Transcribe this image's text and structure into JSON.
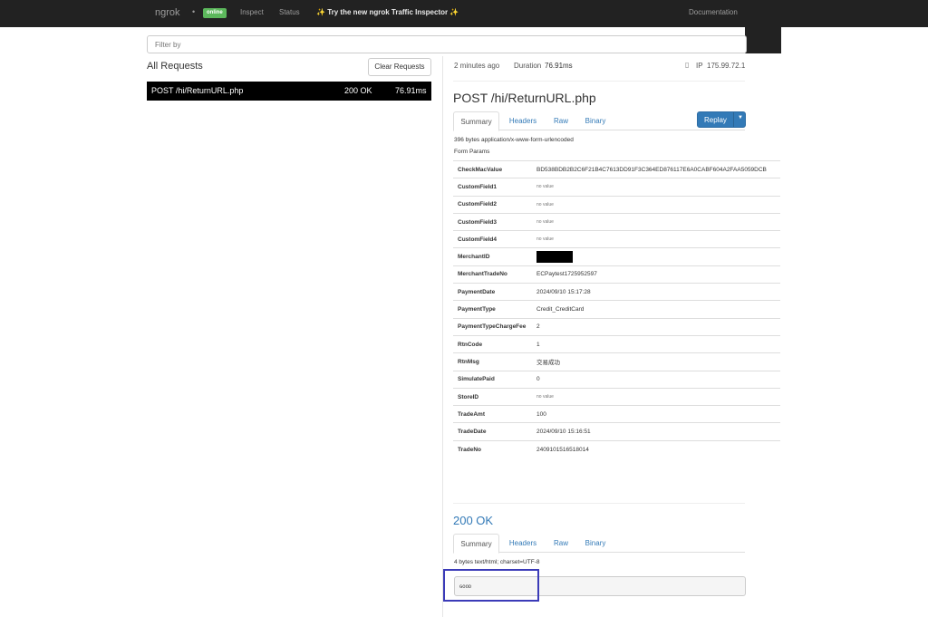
{
  "navbar": {
    "brand": "ngrok",
    "dot": "•",
    "status_badge": "online",
    "links": [
      "Inspect",
      "Status"
    ],
    "promo_text": "Try the new ngrok Traffic Inspector",
    "promo_sparkle": "✨",
    "documentation": "Documentation"
  },
  "filter": {
    "placeholder": "Filter by"
  },
  "left": {
    "heading": "All Requests",
    "clear_button": "Clear Requests",
    "requests": [
      {
        "method_path": "POST /hi/ReturnURL.php",
        "status": "200 OK",
        "duration": "76.91ms"
      }
    ]
  },
  "detail": {
    "time_ago": "2 minutes ago",
    "duration_label": "Duration",
    "duration": "76.91ms",
    "ip_label": "IP",
    "ip": "175.99.72.1",
    "request_title": "POST /hi/ReturnURL.php",
    "request_tabs": [
      "Summary",
      "Headers",
      "Raw",
      "Binary"
    ],
    "replay_button": "Replay",
    "content_type": "396 bytes application/x-www-form-urlencoded",
    "form_params_label": "Form Params",
    "params": [
      {
        "key": "CheckMacValue",
        "value": "BD538BDB2B2C6F21B4C7613DD91F3C364ED876117E6A0CABF604A2FAA5059DCB"
      },
      {
        "key": "CustomField1",
        "value": "no value",
        "novalue": true
      },
      {
        "key": "CustomField2",
        "value": "no value",
        "novalue": true
      },
      {
        "key": "CustomField3",
        "value": "no value",
        "novalue": true
      },
      {
        "key": "CustomField4",
        "value": "no value",
        "novalue": true
      },
      {
        "key": "MerchantID",
        "value": "",
        "redacted": true
      },
      {
        "key": "MerchantTradeNo",
        "value": "ECPaytest1725952597"
      },
      {
        "key": "PaymentDate",
        "value": "2024/09/10 15:17:28"
      },
      {
        "key": "PaymentType",
        "value": "Credit_CreditCard"
      },
      {
        "key": "PaymentTypeChargeFee",
        "value": "2"
      },
      {
        "key": "RtnCode",
        "value": "1"
      },
      {
        "key": "RtnMsg",
        "value": "交易成功"
      },
      {
        "key": "SimulatePaid",
        "value": "0"
      },
      {
        "key": "StoreID",
        "value": "no value",
        "novalue": true
      },
      {
        "key": "TradeAmt",
        "value": "100"
      },
      {
        "key": "TradeDate",
        "value": "2024/09/10 15:16:51"
      },
      {
        "key": "TradeNo",
        "value": "2409101516518014"
      }
    ],
    "response_title": "200 OK",
    "response_tabs": [
      "Summary",
      "Headers",
      "Raw",
      "Binary"
    ],
    "response_content_type": "4 bytes text/html; charset=UTF-8",
    "response_body": "GOOD"
  },
  "colors": {
    "navbar": "#222222",
    "online_badge": "#5cb85c",
    "replay_button": "#337ab7",
    "link": "#337ab7",
    "highlight_box": "#3b3bb8"
  }
}
